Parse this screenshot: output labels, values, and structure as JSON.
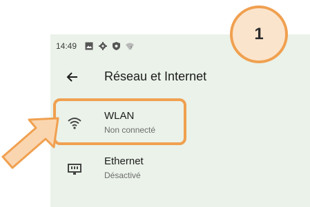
{
  "status_bar": {
    "time": "14:49",
    "icons": [
      "gallery-icon",
      "gear-icon",
      "shield-icon",
      "wifi-no-internet-icon"
    ]
  },
  "app_bar": {
    "back_icon": "arrow-left-icon",
    "title": "Réseau et Internet"
  },
  "settings": [
    {
      "icon": "wifi-icon",
      "title": "WLAN",
      "subtitle": "Non connecté"
    },
    {
      "icon": "ethernet-icon",
      "title": "Ethernet",
      "subtitle": "Désactivé"
    }
  ],
  "annotation": {
    "step_number": "1",
    "accent_color": "#f0a050"
  }
}
